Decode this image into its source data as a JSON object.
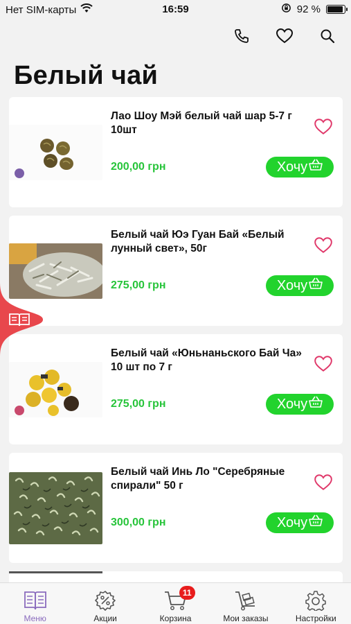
{
  "status_bar": {
    "carrier": "Нет SIM-карты",
    "time": "16:59",
    "battery": "92 %",
    "battery_level": 0.92
  },
  "header": {
    "title": "Белый чай",
    "icons": [
      "phone-icon",
      "heart-icon",
      "search-icon"
    ]
  },
  "products": [
    {
      "name": "Лао Шоу Мэй белый чай шар 5-7 г 10шт",
      "price": "200,00 грн",
      "buy_label": "Хочу"
    },
    {
      "name": "Белый чай  Юэ Гуан Бай   «Белый лунный свет», 50г",
      "price": "275,00 грн",
      "buy_label": "Хочу"
    },
    {
      "name": "Белый чай «Юньнаньского Бай Ча» 10 шт по 7 г",
      "price": "275,00 грн",
      "buy_label": "Хочу"
    },
    {
      "name": "Белый чай Инь Ло \"Серебряные спирали\" 50 г",
      "price": "300,00 грн",
      "buy_label": "Хочу"
    }
  ],
  "tabbar": {
    "items": [
      {
        "label": "Меню",
        "icon": "menu-book-icon",
        "active": true
      },
      {
        "label": "Акции",
        "icon": "discount-badge-icon"
      },
      {
        "label": "Корзина",
        "icon": "cart-icon",
        "badge": "11"
      },
      {
        "label": "Мои заказы",
        "icon": "trolley-icon"
      },
      {
        "label": "Настройки",
        "icon": "gear-icon"
      }
    ]
  },
  "colors": {
    "accent_green": "#22d32d",
    "price_green": "#27c43a",
    "heart_pink": "#e0386a",
    "active_tab": "#8a6bbd",
    "side_tab_red": "#e8474c",
    "badge_red": "#e81c1c"
  }
}
